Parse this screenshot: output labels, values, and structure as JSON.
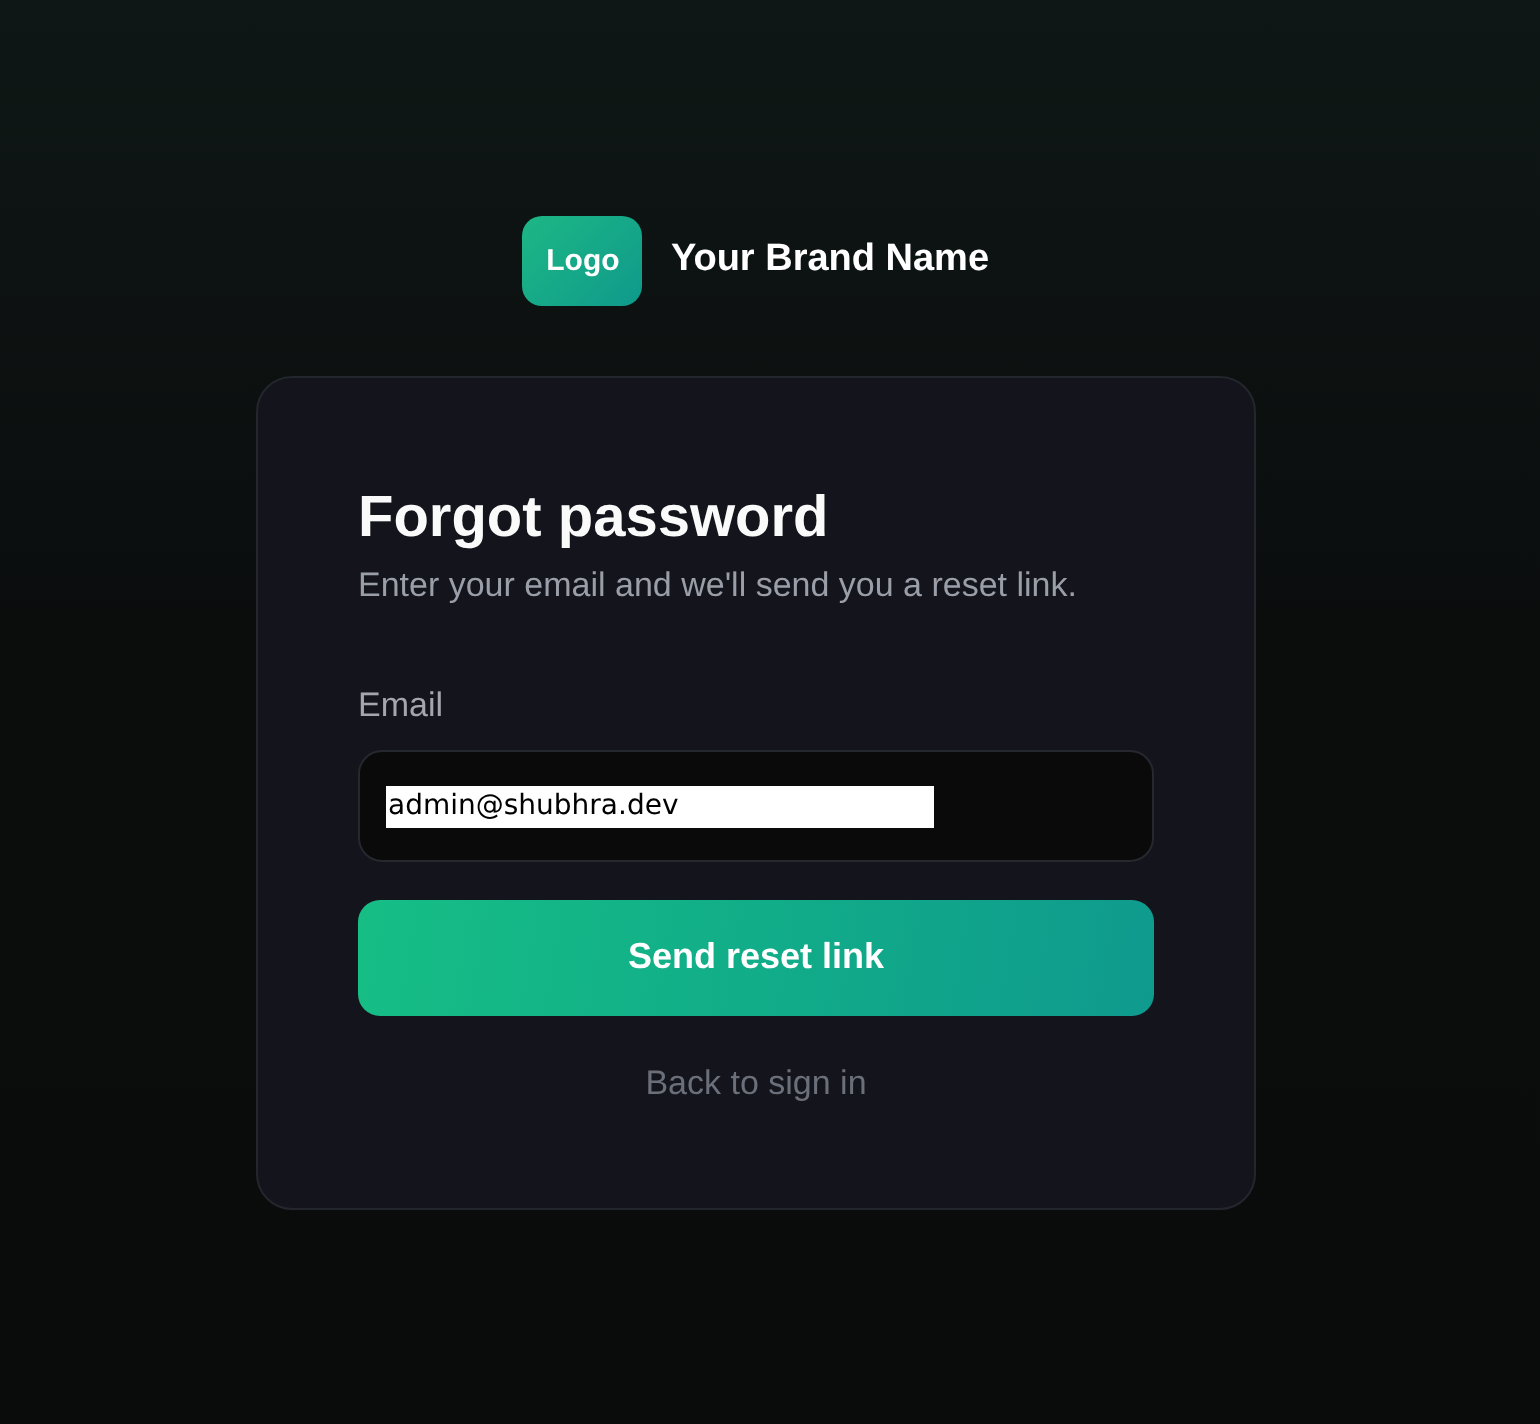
{
  "brand": {
    "logo": "Logo",
    "name": "Your Brand Name"
  },
  "card": {
    "title": "Forgot password",
    "subtitle": "Enter your email and we'll send you a reset link.",
    "fields": [
      {
        "label": "Email",
        "value": "admin@shubhra.dev",
        "autofilled": true
      }
    ],
    "submit": "Send reset link",
    "back_link": "Back to sign in"
  }
}
